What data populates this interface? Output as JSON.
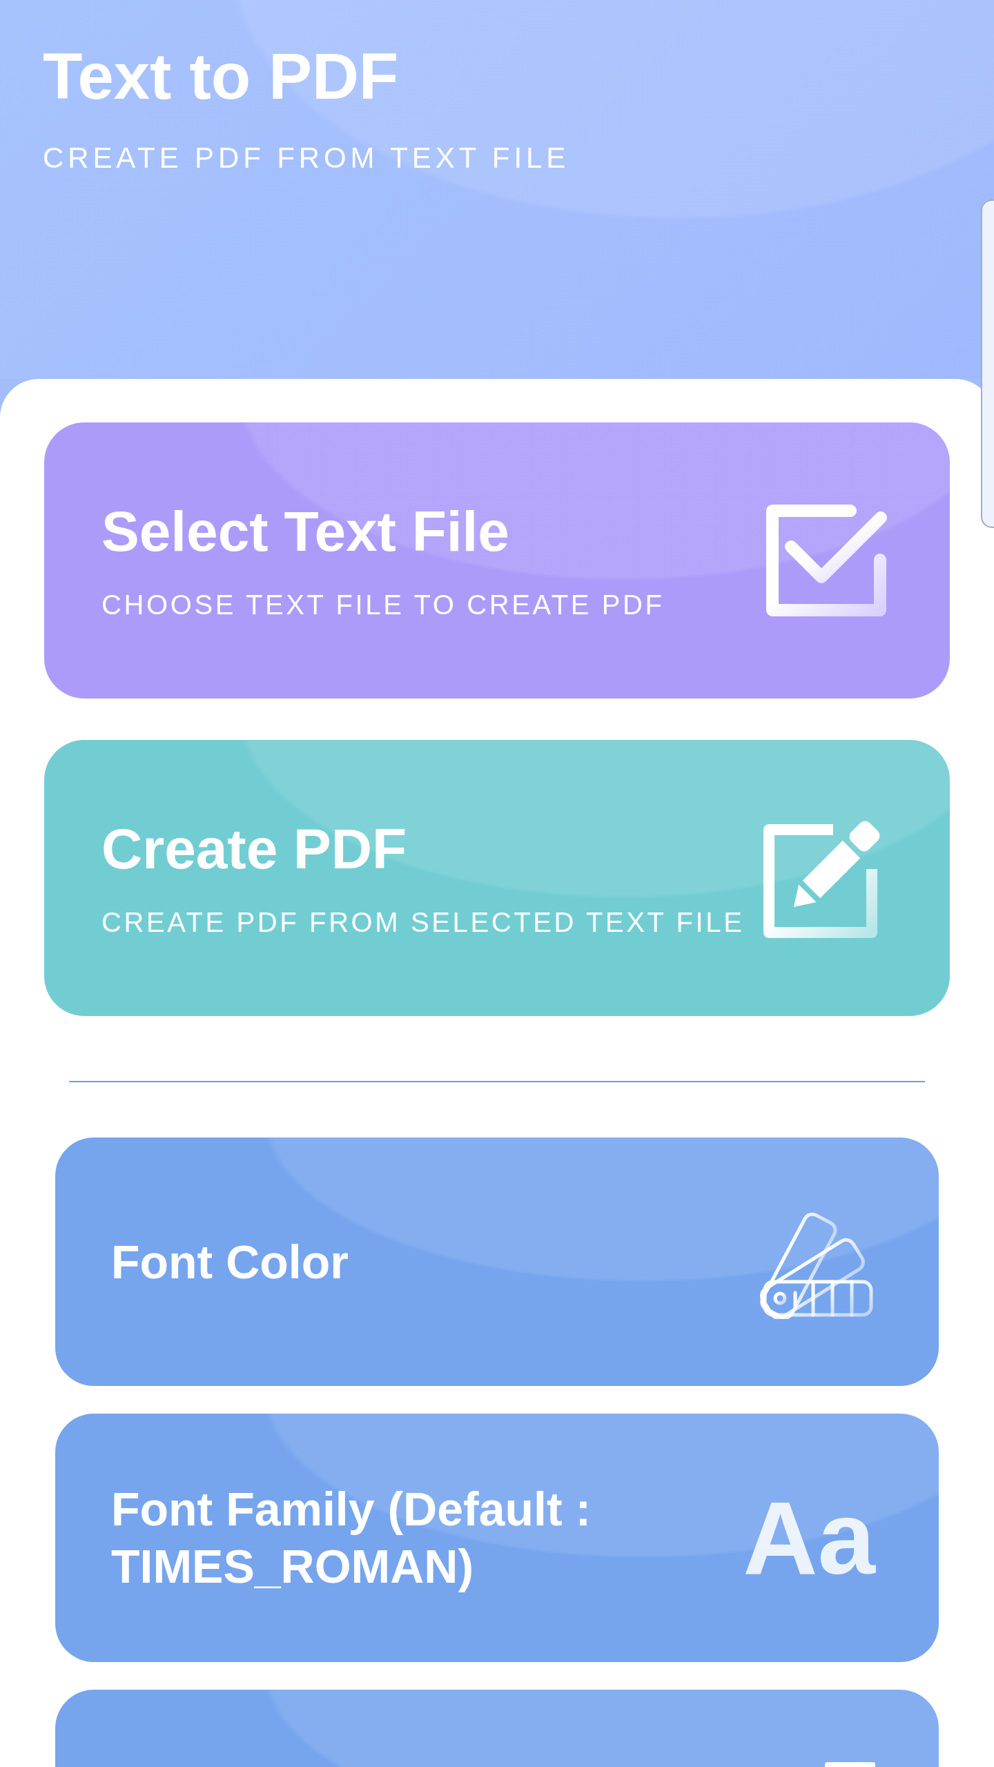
{
  "header": {
    "title": "Text to PDF",
    "subtitle": "CREATE PDF FROM TEXT FILE"
  },
  "actions": [
    {
      "kind": "select",
      "title": "Select Text File",
      "subtitle": "CHOOSE TEXT FILE TO CREATE PDF",
      "color": "#ad9bfa"
    },
    {
      "kind": "create",
      "title": "Create PDF",
      "subtitle": "CREATE PDF FROM SELECTED TEXT FILE",
      "color": "#72cdd3"
    }
  ],
  "options": [
    {
      "kind": "font_color",
      "title": "Font Color"
    },
    {
      "kind": "font_family",
      "title": "Font Family (Default : TIMES_ROMAN)",
      "icon_glyph": "Aa"
    },
    {
      "kind": "partial"
    }
  ]
}
